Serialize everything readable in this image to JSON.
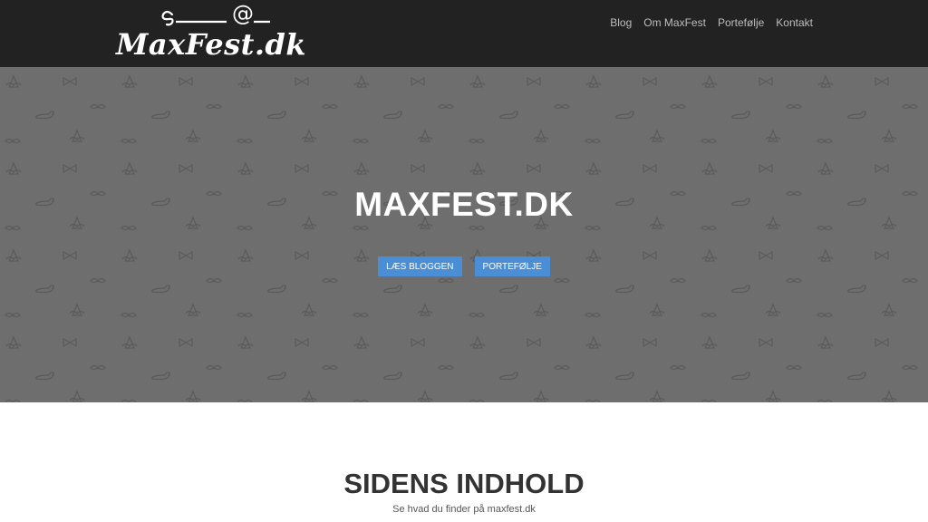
{
  "header": {
    "logo_text": "MaxFest.dk",
    "nav": [
      {
        "label": "Blog"
      },
      {
        "label": "Om MaxFest"
      },
      {
        "label": "Portefølje"
      },
      {
        "label": "Kontakt"
      }
    ]
  },
  "hero": {
    "title": "MAXFEST.DK",
    "buttons": {
      "blog": "LÆS BLOGGEN",
      "portfolio": "PORTEFØLJE"
    },
    "background_color": "#6e6e6e",
    "pattern_icons": [
      "party-hat-icon",
      "pipe-icon",
      "mustache-icon",
      "bow-tie-icon"
    ]
  },
  "content": {
    "title": "SIDENS INDHOLD",
    "subtitle": "Se hvad du finder på maxfest.dk"
  },
  "colors": {
    "topbar": "#222222",
    "accent": "#4a8fd6",
    "nav_text": "#bdbdbd"
  }
}
